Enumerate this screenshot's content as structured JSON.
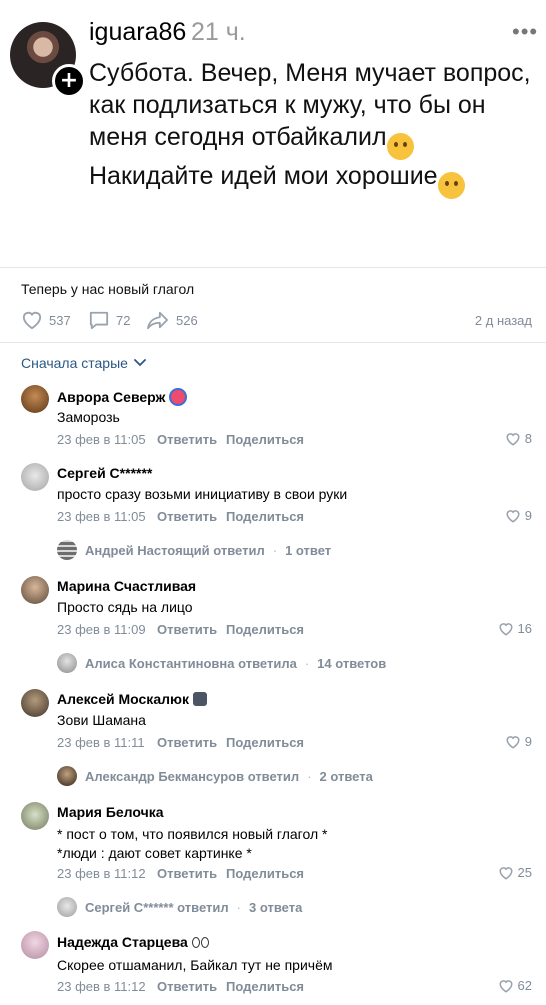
{
  "post": {
    "author": "iguara86",
    "time": "21 ч.",
    "menu": "•••",
    "text_part1": "Суббота. Вечер, Меня мучает вопрос, как подлизаться к мужу, что бы он меня сегодня отбайкалил",
    "text_part2": " Накидайте идей мои хорошие",
    "emoji1": "🤭",
    "emoji2": "😅"
  },
  "caption": "Теперь у нас новый глагол",
  "stats": {
    "likes": "537",
    "comments": "72",
    "shares": "526",
    "date": "2 д назад"
  },
  "sort_label": "Сначала старые",
  "actions": {
    "reply": "Ответить",
    "share": "Поделиться"
  },
  "comments": [
    {
      "name": "Аврора Северж",
      "text": "Заморозь",
      "time": "23 фев в 11:05",
      "likes": "8"
    },
    {
      "name": "Сергей С******",
      "text": "просто сразу возьми инициативу в свои руки",
      "time": "23 фев в 11:05",
      "likes": "9",
      "reply_author": "Андрей Настоящий ответил",
      "reply_count": "1 ответ"
    },
    {
      "name": "Марина Счастливая",
      "text": "Просто сядь на лицо",
      "time": "23 фев в 11:09",
      "likes": "16",
      "reply_author": "Алиса Константиновна ответила",
      "reply_count": "14 ответов"
    },
    {
      "name": "Алексей Москалюк",
      "text": "Зови Шамана",
      "time": "23 фев в 11:11",
      "likes": "9",
      "reply_author": "Александр Бекмансуров ответил",
      "reply_count": "2 ответа"
    },
    {
      "name": "Мария Белочка",
      "text_line1": "* пост о том, что появился новый глагол *",
      "text_line2": "*люди : дают совет картинке *",
      "time": "23 фев в 11:12",
      "likes": "25",
      "reply_author": "Сергей С****** ответил",
      "reply_count": "3 ответа"
    },
    {
      "name": "Надежда Старцева",
      "text": "Скорее отшаманил, Байкал тут не причём",
      "time": "23 фев в 11:12",
      "likes": "62"
    }
  ],
  "colors": {
    "link": "#2a5885",
    "meta": "#818c99",
    "divider": "#e4e6ea"
  }
}
